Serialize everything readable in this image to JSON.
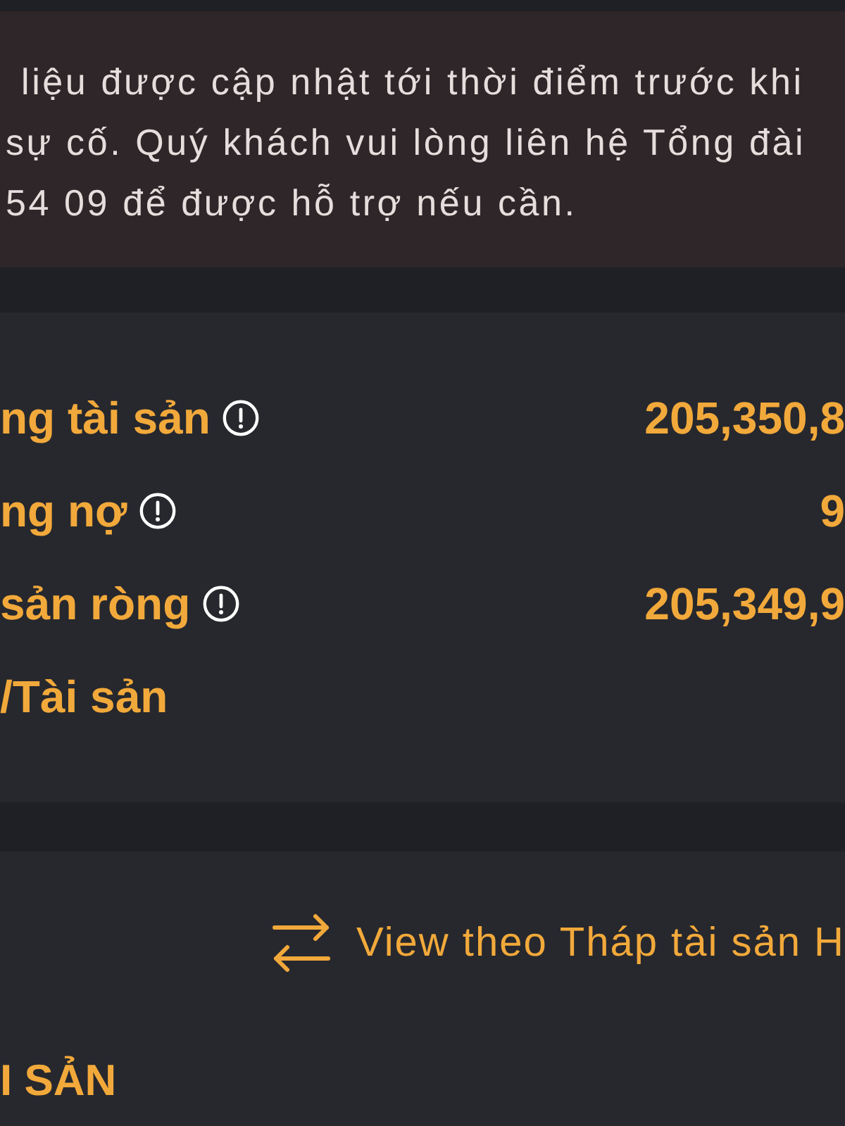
{
  "notice": {
    "text": "liệu được cập nhật tới thời điểm trước khi\nsự cố. Quý khách vui lòng liên hệ Tổng đài\n54 09 để được hỗ trợ nếu cần."
  },
  "summary": {
    "rows": [
      {
        "label": "ng tài sản",
        "info": true,
        "value": "205,350,8"
      },
      {
        "label": "ng nợ",
        "info": true,
        "value": "9"
      },
      {
        "label": "sản ròng",
        "info": true,
        "value": "205,349,9"
      },
      {
        "label": "/Tài sản",
        "info": false
      }
    ]
  },
  "view_toggle": {
    "label": "View theo Tháp tài sản H"
  },
  "section_title": "I SẢN"
}
